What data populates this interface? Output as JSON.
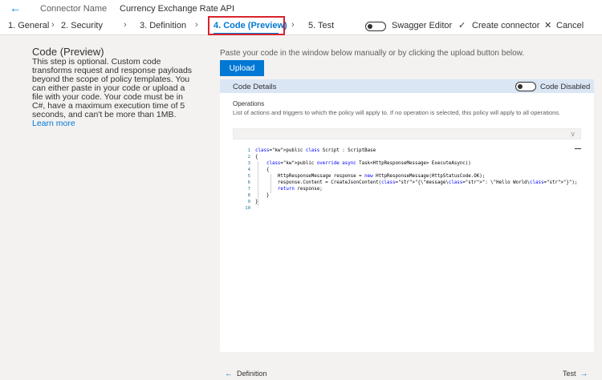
{
  "header": {
    "connector_name_label": "Connector Name",
    "connector_name_value": "Currency Exchange Rate API"
  },
  "steps": {
    "general": "1. General",
    "security": "2. Security",
    "definition": "3. Definition",
    "code": "4. Code (Preview)",
    "test": "5. Test"
  },
  "toolbar": {
    "swagger_editor": "Swagger Editor",
    "create_connector": "Create connector",
    "cancel": "Cancel"
  },
  "left": {
    "title": "Code (Preview)",
    "description": "This step is optional. Custom code transforms request and response payloads beyond the scope of policy templates. You can either paste in your code or upload a file with your code. Your code must be in C#, have a maximum execution time of 5 seconds, and can't be more than 1MB. ",
    "learn_more": "Learn more"
  },
  "main": {
    "paste_hint": "Paste your code in the window below manually or by clicking the upload button below.",
    "upload_label": "Upload",
    "panel_title": "Code Details",
    "code_toggle_label": "Code Disabled",
    "operations_label": "Operations",
    "operations_desc": "List of actions and triggers to which the policy will apply to. If no operation is selected, this policy will apply to all operations.",
    "operations_selected": ""
  },
  "code": {
    "line_numbers": [
      "1",
      "2",
      "3",
      "4",
      "5",
      "6",
      "7",
      "8",
      "9",
      "10"
    ],
    "lines": [
      "public class Script : ScriptBase",
      "{",
      "    public override async Task<HttpResponseMessage> ExecuteAsync()",
      "    {",
      "        HttpResponseMessage response = new HttpResponseMessage(HttpStatusCode.OK);",
      "        response.Content = CreateJsonContent(\"{\\\"message\\\": \\\"Hello World\\\"}\");",
      "        return response;",
      "    }",
      "}",
      ""
    ]
  },
  "footer": {
    "back_label": "Definition",
    "next_label": "Test"
  },
  "colors": {
    "accent": "#0078d4",
    "highlight": "#d9232d"
  }
}
